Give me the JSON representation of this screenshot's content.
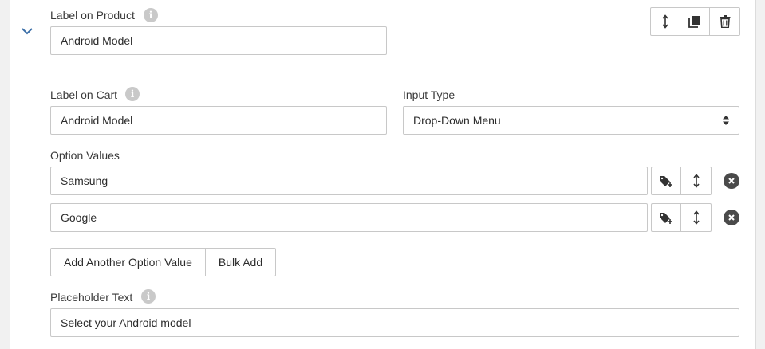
{
  "label_on_product": {
    "label": "Label on Product",
    "value": "Android Model"
  },
  "label_on_cart": {
    "label": "Label on Cart",
    "value": "Android Model"
  },
  "input_type": {
    "label": "Input Type",
    "value": "Drop-Down Menu"
  },
  "option_values": {
    "label": "Option Values",
    "items": [
      {
        "value": "Samsung"
      },
      {
        "value": "Google"
      }
    ]
  },
  "buttons": {
    "add_another": "Add Another Option Value",
    "bulk_add": "Bulk Add"
  },
  "placeholder_text": {
    "label": "Placeholder Text",
    "value": "Select your Android model"
  },
  "icons": {
    "info": "info-icon",
    "collapse": "chevron-down-icon",
    "reorder": "up-down-arrows-icon",
    "duplicate": "copy-icon",
    "delete": "trash-icon",
    "add_price": "tag-plus-icon",
    "remove": "remove-circle-icon"
  },
  "colors": {
    "accent": "#3c6fa8",
    "remove_bg": "#4a4a4a",
    "border": "#c8c8c8"
  }
}
